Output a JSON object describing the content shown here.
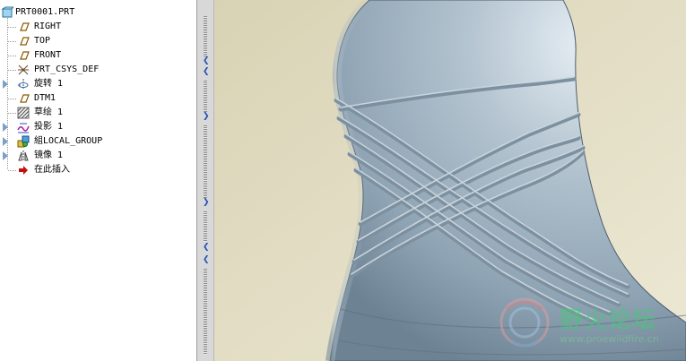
{
  "model_tree": {
    "items": [
      {
        "label": "PRT0001.PRT",
        "icon": "part-icon",
        "expandable": false
      },
      {
        "label": "RIGHT",
        "icon": "datum-plane-icon",
        "expandable": false
      },
      {
        "label": "TOP",
        "icon": "datum-plane-icon",
        "expandable": false
      },
      {
        "label": "FRONT",
        "icon": "datum-plane-icon",
        "expandable": false
      },
      {
        "label": "PRT_CSYS_DEF",
        "icon": "coordinate-system-icon",
        "expandable": false
      },
      {
        "label": "旋转 1",
        "icon": "revolve-icon",
        "expandable": true
      },
      {
        "label": "DTM1",
        "icon": "datum-plane-icon",
        "expandable": false
      },
      {
        "label": "草绘 1",
        "icon": "sketch-icon",
        "expandable": false
      },
      {
        "label": "投影 1",
        "icon": "projection-icon",
        "expandable": true
      },
      {
        "label": "組LOCAL_GROUP",
        "icon": "group-icon",
        "expandable": true
      },
      {
        "label": "镜像 1",
        "icon": "mirror-icon",
        "expandable": true
      },
      {
        "label": "在此插入",
        "icon": "insert-here-arrow-icon",
        "expandable": false
      }
    ]
  },
  "watermark": {
    "title": "野火论坛",
    "url": "www.proewildfire.cn"
  },
  "colors": {
    "background": "#e4dfc2",
    "model": "#aebfcc",
    "accent": "#1f4fb0"
  }
}
